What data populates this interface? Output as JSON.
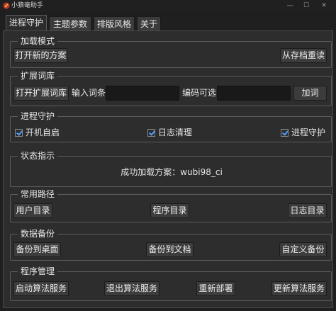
{
  "window": {
    "title": "小狼毫助手",
    "minimize_symbol": "—",
    "maximize_symbol": "☐",
    "close_symbol": "✕",
    "app_icon": "hair-brush-icon",
    "accent_color": "#4ea1ff"
  },
  "tabs": [
    {
      "label": "进程守护",
      "active": true
    },
    {
      "label": "主题参数",
      "active": false
    },
    {
      "label": "排版风格",
      "active": false
    },
    {
      "label": "关于",
      "active": false
    }
  ],
  "load_mode": {
    "title": "加载模式",
    "open_scheme_button": "打开新的方案",
    "redeploy_from_archive_button": "从存档重读"
  },
  "dict_extend": {
    "title": "扩展词库",
    "open_dict_button": "打开扩展词库",
    "input_word_label": "输入词条",
    "input_word_value": "",
    "code_label": "编码可选",
    "code_value": "",
    "add_word_button": "加词"
  },
  "daemon": {
    "title": "进程守护",
    "autostart": {
      "label": "开机自启",
      "checked": true
    },
    "log_clean": {
      "label": "日志清理",
      "checked": true
    },
    "process_guard": {
      "label": "进程守护",
      "checked": true
    }
  },
  "status": {
    "title": "状态指示",
    "message": "成功加载方案：wubi98_ci"
  },
  "paths": {
    "title": "常用路径",
    "user_dir_button": "用户目录",
    "program_dir_button": "程序目录",
    "log_dir_button": "日志目录"
  },
  "backup": {
    "title": "数据备份",
    "backup_desktop_button": "备份到桌面",
    "backup_documents_button": "备份到文档",
    "custom_backup_button": "自定义备份"
  },
  "program": {
    "title": "程序管理",
    "start_service_button": "启动算法服务",
    "stop_service_button": "退出算法服务",
    "redeploy_button": "重新部署",
    "update_service_button": "更新算法服务"
  }
}
